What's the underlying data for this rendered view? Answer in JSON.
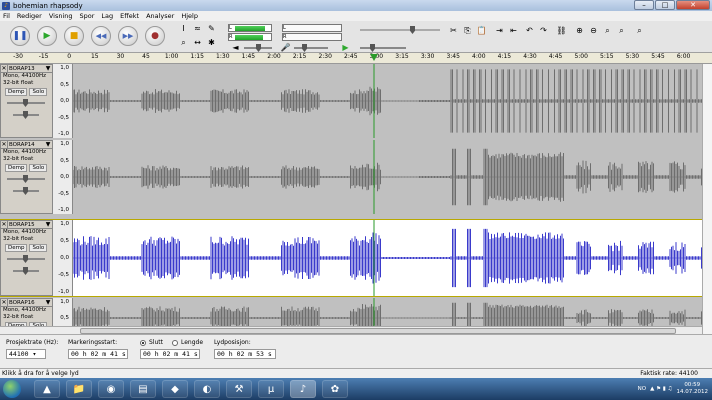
{
  "window": {
    "title": "bohemian rhapsody",
    "min": "–",
    "max": "□",
    "close": "✕"
  },
  "menu": [
    "Fil",
    "Rediger",
    "Visning",
    "Spor",
    "Lag",
    "Effekt",
    "Analyser",
    "Hjelp"
  ],
  "transport": {
    "pause_icon": "❚❚",
    "play_icon": "▶",
    "stop_icon": "■",
    "skip_start_icon": "◀◀",
    "skip_end_icon": "▶▶",
    "record_icon": "●"
  },
  "meters": {
    "l": "L",
    "r": "R",
    "zero": "0"
  },
  "ruler": [
    "-30",
    "-15",
    "0",
    "15",
    "30",
    "45",
    "1:00",
    "1:15",
    "1:30",
    "1:45",
    "2:00",
    "2:15",
    "2:30",
    "2:45",
    "3:00",
    "3:15",
    "3:30",
    "3:45",
    "4:00",
    "4:15",
    "4:30",
    "4:45",
    "5:00",
    "5:15",
    "5:30",
    "5:45",
    "6:00"
  ],
  "tracks": [
    {
      "name": "BORAP13",
      "rate": "Mono, 44100Hz",
      "fmt": "32-bit float",
      "mute": "Demp",
      "solo": "Solo",
      "scale": [
        "1,0",
        "0,5",
        "0,0",
        "-0,5",
        "-1,0"
      ],
      "selected": false
    },
    {
      "name": "BORAP14",
      "rate": "Mono, 44100Hz",
      "fmt": "32-bit float",
      "mute": "Demp",
      "solo": "Solo",
      "scale": [
        "1,0",
        "0,5",
        "0,0",
        "-0,5",
        "-1,0"
      ],
      "selected": false
    },
    {
      "name": "BORAP15",
      "rate": "Mono, 44100Hz",
      "fmt": "32-bit float",
      "mute": "Demp",
      "solo": "Solo",
      "scale": [
        "1,0",
        "0,5",
        "0,0",
        "-0,5",
        "-1,0"
      ],
      "selected": true
    },
    {
      "name": "BORAP16",
      "rate": "Mono, 44100Hz",
      "fmt": "32-bit float",
      "mute": "Demp",
      "solo": "Solo",
      "scale": [
        "1,0",
        "0,5"
      ],
      "selected": false
    }
  ],
  "bottom": {
    "project_rate_label": "Prosjektrate (Hz):",
    "project_rate": "44100",
    "selection_start_label": "Markeringsstart:",
    "selection_start": "00 h 02 m 41 s",
    "end_label": "Slutt",
    "length_label": "Lengde",
    "selection_end": "00 h 02 m 41 s",
    "audio_pos_label": "Lydposisjon:",
    "audio_pos": "00 h 02 m 53 s"
  },
  "status": {
    "left": "Klikk å dra for å velge lyd",
    "right": "Faktisk rate: 44100"
  },
  "taskbar": {
    "lang": "NO",
    "time": "00:59",
    "date": "14.07.2012"
  },
  "colors": {
    "waveform": "#6e6e6e",
    "selected_waveform": "#3a3acb",
    "playhead": "#2a9a2a",
    "selection_outline": "#b8a800"
  }
}
